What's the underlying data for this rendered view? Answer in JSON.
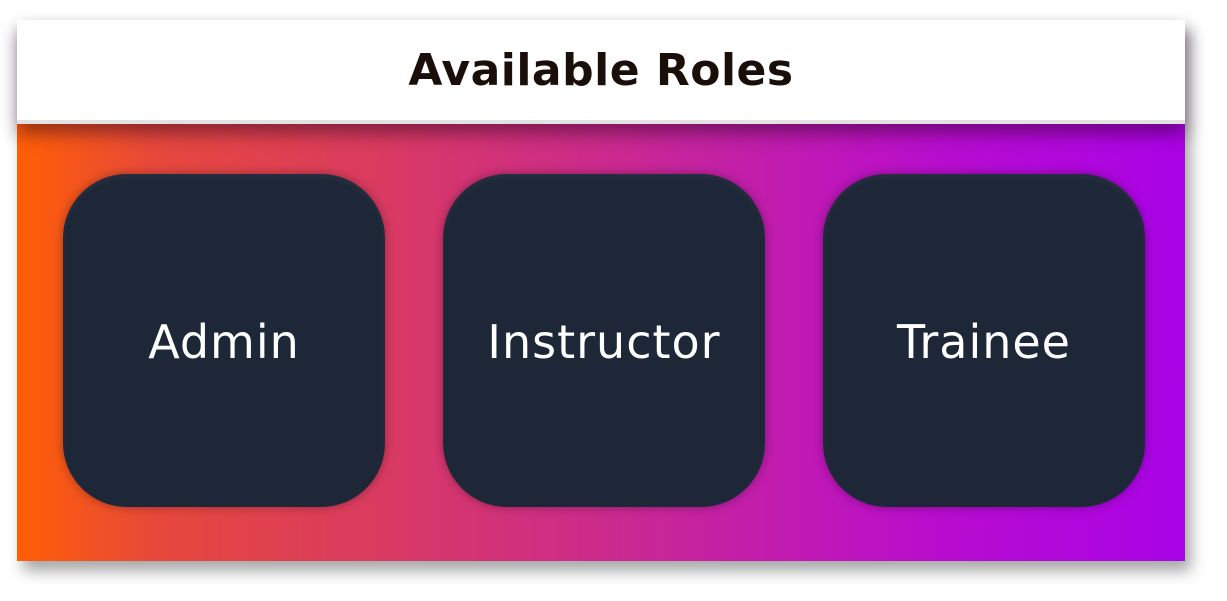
{
  "header": {
    "title": "Available Roles"
  },
  "roles": [
    {
      "label": "Admin"
    },
    {
      "label": "Instructor"
    },
    {
      "label": "Trainee"
    }
  ],
  "colors": {
    "gradient_start": "#ff5f05",
    "gradient_end": "#a903e6",
    "card_background": "#1d2738",
    "header_background": "#ffffff",
    "title_color": "#1a0e0a",
    "card_text": "#ffffff"
  }
}
